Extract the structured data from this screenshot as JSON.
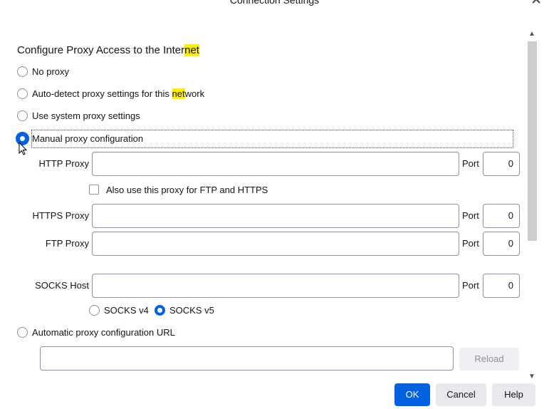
{
  "window": {
    "title": "Connection Settings"
  },
  "section": {
    "heading_pre": "Configure Proxy Access to the Inter",
    "heading_hl": "net"
  },
  "options": {
    "no_proxy": "No proxy",
    "auto_detect_pre": "Auto-detect proxy settings for this ",
    "auto_detect_hl": "net",
    "auto_detect_post": "work",
    "system": "Use system proxy settings",
    "manual": "Manual proxy configuration",
    "auto_url": "Automatic proxy configuration URL",
    "selected": "manual"
  },
  "manual": {
    "http_label": "HTTP Proxy",
    "http_value": "",
    "http_port_label": "Port",
    "http_port": "0",
    "also_use_label": "Also use this proxy for FTP and HTTPS",
    "also_use_checked": false,
    "https_label": "HTTPS Proxy",
    "https_value": "",
    "https_port_label": "Port",
    "https_port": "0",
    "ftp_label": "FTP Proxy",
    "ftp_value": "",
    "ftp_port_label": "Port",
    "ftp_port": "0",
    "socks_label": "SOCKS Host",
    "socks_value": "",
    "socks_port_label": "Port",
    "socks_port": "0",
    "socks_v4": "SOCKS v4",
    "socks_v5": "SOCKS v5",
    "socks_selected": "v5"
  },
  "auto_url": {
    "value": "",
    "reload_label": "Reload"
  },
  "buttons": {
    "ok": "OK",
    "cancel": "Cancel",
    "help": "Help"
  },
  "colors": {
    "accent": "#0061e0",
    "highlight": "#ffef00"
  },
  "icons": {
    "close": "close-icon",
    "cursor": "mouse-pointer-icon"
  }
}
